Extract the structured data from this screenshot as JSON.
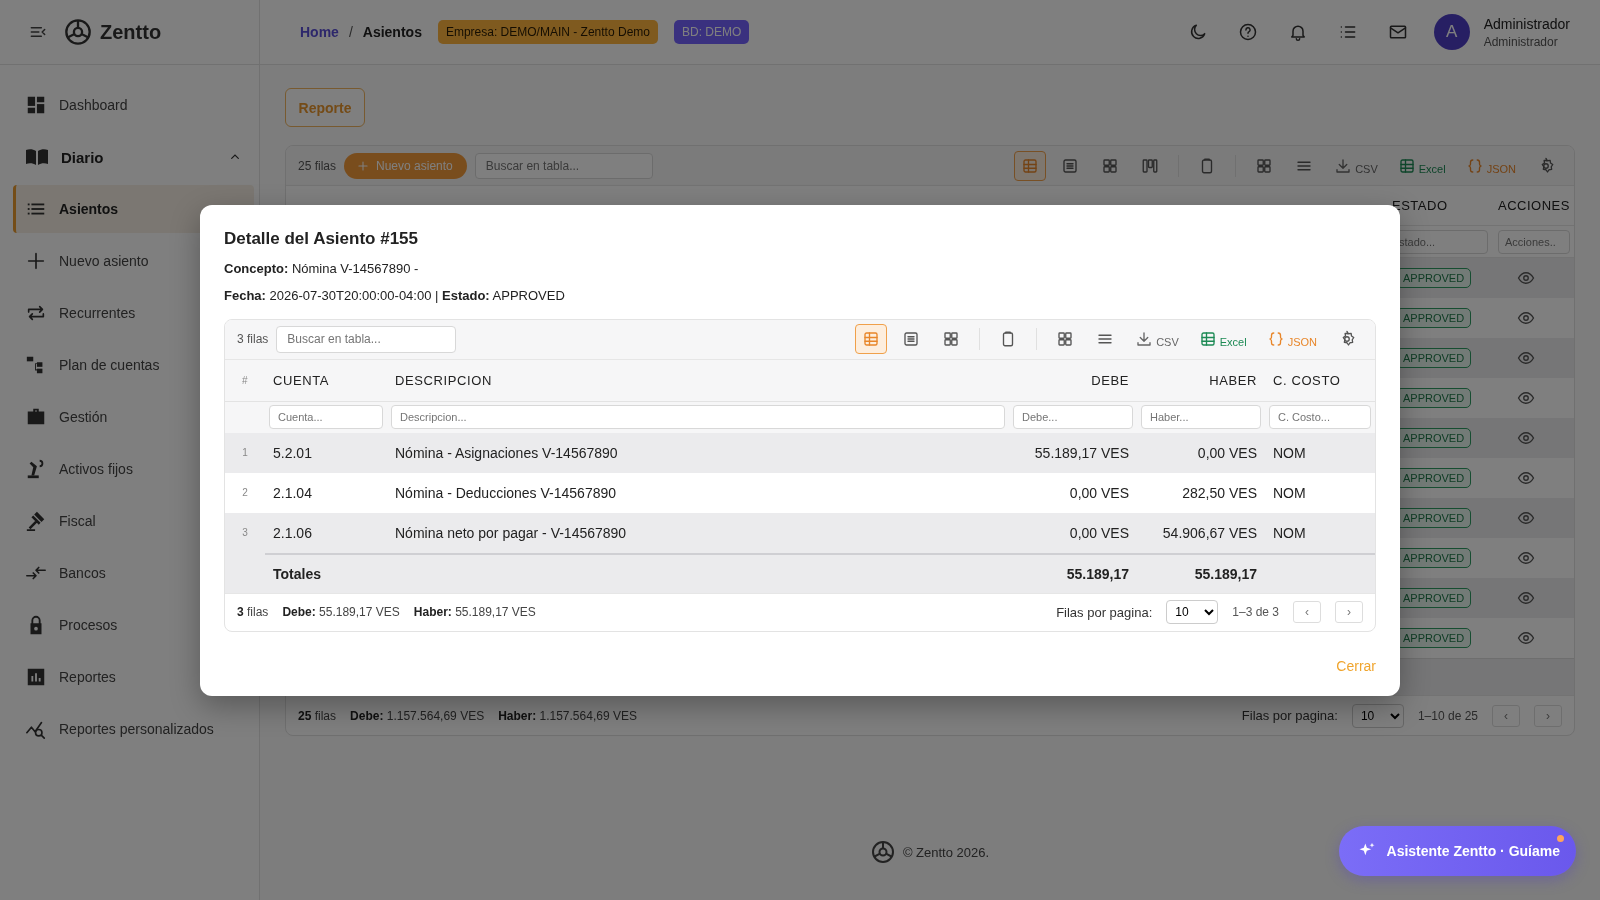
{
  "header": {
    "brand": "Zentto",
    "breadcrumb": {
      "separator": "/",
      "items": [
        {
          "label": "Home",
          "selected": false
        },
        {
          "label": "Asientos",
          "selected": true
        }
      ]
    },
    "badges": [
      {
        "text": "Empresa: DEMO/MAIN - Zentto Demo",
        "kind": "company"
      },
      {
        "text": "BD: DEMO",
        "kind": "database"
      }
    ],
    "user": {
      "initial": "A",
      "name": "Administrador",
      "role": "Administrador"
    }
  },
  "sidebar": {
    "items": [
      {
        "label": "Dashboard",
        "selected": false
      },
      {
        "label": "Diario",
        "selected": false,
        "expanded": true,
        "children": [
          {
            "label": "Asientos",
            "selected": true
          },
          {
            "label": "Nuevo asiento",
            "selected": false
          },
          {
            "label": "Recurrentes",
            "selected": false
          }
        ]
      },
      {
        "label": "Plan de cuentas",
        "selected": false
      },
      {
        "label": "Gestión",
        "selected": false
      },
      {
        "label": "Activos fijos",
        "selected": false
      },
      {
        "label": "Fiscal",
        "selected": false
      },
      {
        "label": "Bancos",
        "selected": false
      },
      {
        "label": "Procesos",
        "selected": false
      },
      {
        "label": "Reportes",
        "selected": false
      },
      {
        "label": "Reportes personalizados",
        "selected": false
      }
    ]
  },
  "page": {
    "report_button": "Reporte",
    "table": {
      "count": "25 filas",
      "new_button": "Nuevo asiento",
      "search": {
        "placeholder": "Buscar en tabla..."
      },
      "views": [
        {
          "selected": true
        },
        {
          "selected": false
        },
        {
          "selected": false
        },
        {
          "selected": false
        }
      ],
      "exports": {
        "csv": "CSV",
        "excel": "Excel",
        "json": "JSON"
      },
      "columns": [
        "ESTADO",
        "ACCIONES"
      ],
      "filters": [
        {
          "placeholder": "stado..."
        },
        {
          "placeholder": "Acciones.."
        }
      ],
      "rows": [
        {
          "estado": "APPROVED"
        },
        {
          "estado": "APPROVED"
        },
        {
          "estado": "APPROVED"
        },
        {
          "estado": "APPROVED"
        },
        {
          "estado": "APPROVED"
        },
        {
          "estado": "APPROVED"
        },
        {
          "estado": "APPROVED"
        },
        {
          "estado": "APPROVED"
        },
        {
          "estado": "APPROVED"
        },
        {
          "estado": "APPROVED"
        }
      ],
      "footer": {
        "summary": [
          "**25** filas",
          "**Debe:** 1.157.564,69 VES",
          "**Haber:** 1.157.564,69 VES"
        ],
        "rows_per_page_label": "Filas por pagina:",
        "rows_per_page": "10",
        "range": "1–10 de 25",
        "prev": "‹",
        "next": "›"
      }
    }
  },
  "modal": {
    "title": "Detalle del Asiento #155",
    "lines": [
      "**Concepto:** Nómina V-14567890 -",
      "**Fecha:** 2026-07-30T20:00:00-04:00 | **Estado:** APPROVED"
    ],
    "table": {
      "count": "3 filas",
      "search": {
        "placeholder": "Buscar en tabla..."
      },
      "views": [
        {
          "selected": true
        },
        {
          "selected": false
        },
        {
          "selected": false
        }
      ],
      "exports": {
        "csv": "CSV",
        "excel": "Excel",
        "json": "JSON"
      },
      "columns": [
        "#",
        "CUENTA",
        "DESCRIPCION",
        "DEBE",
        "HABER",
        "C. COSTO"
      ],
      "filters": [
        {
          "placeholder": "Cuenta..."
        },
        {
          "placeholder": "Descripcion..."
        },
        {
          "placeholder": "Debe..."
        },
        {
          "placeholder": "Haber..."
        },
        {
          "placeholder": "C. Costo..."
        }
      ],
      "rows": [
        {
          "n": "1",
          "cuenta": "5.2.01",
          "descripcion": "Nómina - Asignaciones V-14567890",
          "debe": "55.189,17 VES",
          "haber": "0,00 VES",
          "costo": "NOM"
        },
        {
          "n": "2",
          "cuenta": "2.1.04",
          "descripcion": "Nómina - Deducciones V-14567890",
          "debe": "0,00 VES",
          "haber": "282,50 VES",
          "costo": "NOM"
        },
        {
          "n": "3",
          "cuenta": "2.1.06",
          "descripcion": "Nómina neto por pagar - V-14567890",
          "debe": "0,00 VES",
          "haber": "54.906,67 VES",
          "costo": "NOM"
        }
      ],
      "totals": {
        "label": "Totales",
        "debe": "55.189,17",
        "haber": "55.189,17"
      },
      "footer": {
        "summary": [
          "**3** filas",
          "**Debe:** 55.189,17 VES",
          "**Haber:** 55.189,17 VES"
        ],
        "rows_per_page_label": "Filas por pagina:",
        "rows_per_page": "10",
        "range": "1–3 de 3",
        "prev": "‹",
        "next": "›"
      }
    },
    "close_button": "Cerrar"
  },
  "footer": {
    "copyright": "© Zentto 2026."
  },
  "assistant": {
    "label": "Asistente Zentto · Guíame",
    "notification": true
  }
}
